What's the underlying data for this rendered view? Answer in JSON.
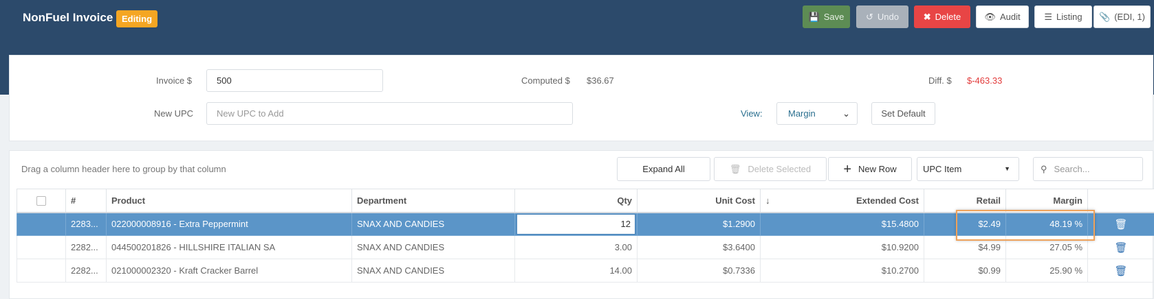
{
  "header": {
    "title": "NonFuel Invoice",
    "badge": "Editing",
    "buttons": {
      "save": "Save",
      "undo": "Undo",
      "delete": "Delete",
      "audit": "Audit",
      "listing": "Listing",
      "edi": "(EDI, 1)"
    }
  },
  "form": {
    "invoice_label": "Invoice $",
    "invoice_value": "500",
    "computed_label": "Computed $",
    "computed_value": "$36.67",
    "diff_label": "Diff. $",
    "diff_value": "$-463.33",
    "diff_color": "#e23b3b",
    "upc_label": "New UPC",
    "upc_placeholder": "New UPC to Add",
    "view_label": "View:",
    "view_value": "Margin",
    "set_default": "Set Default"
  },
  "grid_toolbar": {
    "group_hint": "Drag a column header here to group by that column",
    "expand_all": "Expand All",
    "delete_selected": "Delete Selected",
    "new_row": "New Row",
    "item_type": "UPC Item",
    "search_placeholder": "Search..."
  },
  "grid": {
    "columns": [
      "#",
      "Product",
      "Department",
      "Qty",
      "Unit Cost",
      "Extended Cost",
      "Retail",
      "Margin"
    ],
    "rows": [
      {
        "num": "2283...",
        "product": "022000008916 - Extra Peppermint",
        "department": "SNAX AND CANDIES",
        "qty": "12",
        "unit_cost": "$1.2900",
        "extended_cost": "$15.4800",
        "retail": "$2.49",
        "margin": "48.19 %"
      },
      {
        "num": "2282...",
        "product": "044500201826 - HILLSHIRE ITALIAN SA",
        "department": "SNAX AND CANDIES",
        "qty": "3.00",
        "unit_cost": "$3.6400",
        "extended_cost": "$10.9200",
        "retail": "$4.99",
        "margin": "27.05 %"
      },
      {
        "num": "2282...",
        "product": "021000002320 - Kraft Cracker Barrel",
        "department": "SNAX AND CANDIES",
        "qty": "14.00",
        "unit_cost": "$0.7336",
        "extended_cost": "$10.2700",
        "retail": "$0.99",
        "margin": "25.90 %"
      }
    ]
  }
}
